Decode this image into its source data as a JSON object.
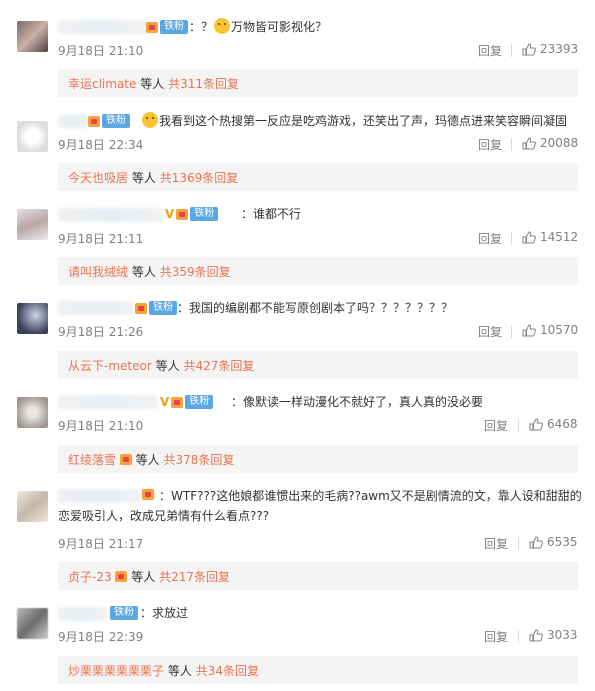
{
  "badge_label": "铁粉",
  "reply_label": "回复",
  "sub_mid": "等人",
  "colors": {
    "accent": "#eb7350",
    "muted": "#808080",
    "badge": "#5aa7e1"
  },
  "comments": [
    {
      "prefix": "：？",
      "suffix": "万物皆可影视化？",
      "time": "9月18日 21:10",
      "likes": "23393",
      "sub_user": "幸运climate",
      "sub_count": "共311条回复"
    },
    {
      "prefix": "",
      "suffix": "我看到这个热搜第一反应是吃鸡游戏，还笑出了声，玛德点进来笑容瞬间凝固",
      "time": "9月18日 22:34",
      "likes": "20088",
      "sub_user": "今天也吸居",
      "sub_count": "共1369条回复"
    },
    {
      "prefix": "",
      "suffix": "：谁都不行",
      "time": "9月18日 21:11",
      "likes": "14512",
      "sub_user": "请叫我绒绒",
      "sub_count": "共359条回复"
    },
    {
      "prefix": "",
      "suffix": "：我国的编剧都不能写原创剧本了吗？？？？？？？",
      "time": "9月18日 21:26",
      "likes": "10570",
      "sub_user": "从云下-meteor",
      "sub_count": "共427条回复"
    },
    {
      "prefix": "",
      "suffix": "：像默读一样动漫化不就好了，真人真的没必要",
      "time": "9月18日 21:10",
      "likes": "6468",
      "sub_user": "红绫落雪",
      "sub_count": "共378条回复"
    },
    {
      "prefix": "",
      "suffix": "：WTF???这他娘都谁惯出来的毛病??awm又不是剧情流的文，靠人设和甜甜的恋爱吸引人，改成兄弟情有什么看点???",
      "time": "9月18日 21:17",
      "likes": "6535",
      "sub_user": "贞子-23",
      "sub_count": "共217条回复"
    },
    {
      "prefix": "",
      "suffix": "：求放过",
      "time": "9月18日 22:39",
      "likes": "3033",
      "sub_user": "炒栗栗栗栗栗栗子",
      "sub_count": "共34条回复"
    }
  ]
}
